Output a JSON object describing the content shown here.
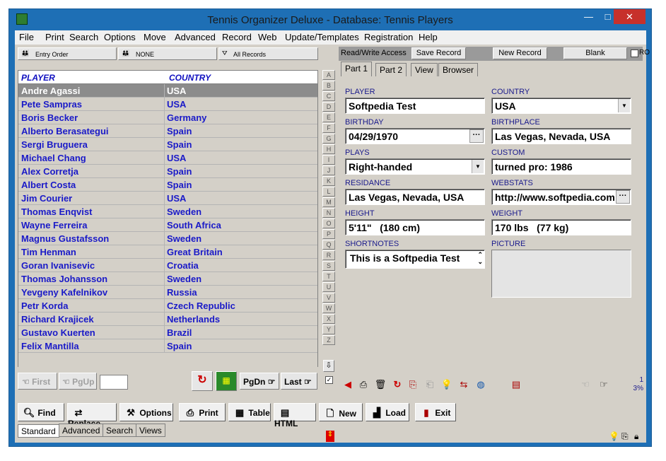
{
  "window": {
    "title": "Tennis Organizer Deluxe - Database: Tennis Players",
    "min": "—",
    "max": "□",
    "close": "✕"
  },
  "menu": [
    "File",
    "Print",
    "Search",
    "Options",
    "Move",
    "Advanced",
    "Record",
    "Web",
    "Update/Templates",
    "Registration",
    "Help"
  ],
  "sortbar": {
    "entry_order": "Entry Order",
    "none": "NONE",
    "all_records": "All Records"
  },
  "list": {
    "columns": [
      "PLAYER",
      "COUNTRY"
    ],
    "rows": [
      {
        "player": "Andre Agassi",
        "country": "USA"
      },
      {
        "player": "Pete Sampras",
        "country": "USA"
      },
      {
        "player": "Boris Becker",
        "country": "Germany"
      },
      {
        "player": "Alberto Berasategui",
        "country": "Spain"
      },
      {
        "player": "Sergi Bruguera",
        "country": "Spain"
      },
      {
        "player": "Michael Chang",
        "country": "USA"
      },
      {
        "player": "Alex Corretja",
        "country": "Spain"
      },
      {
        "player": "Albert Costa",
        "country": "Spain"
      },
      {
        "player": "Jim Courier",
        "country": "USA"
      },
      {
        "player": "Thomas Enqvist",
        "country": "Sweden"
      },
      {
        "player": "Wayne Ferreira",
        "country": "South Africa"
      },
      {
        "player": "Magnus Gustafsson",
        "country": "Sweden"
      },
      {
        "player": "Tim Henman",
        "country": "Great Britain"
      },
      {
        "player": "Goran Ivanisevic",
        "country": "Croatia"
      },
      {
        "player": "Thomas Johansson",
        "country": "Sweden"
      },
      {
        "player": "Yevgeny Kafelnikov",
        "country": "Russia"
      },
      {
        "player": "Petr Korda",
        "country": "Czech Republic"
      },
      {
        "player": "Richard Krajicek",
        "country": "Netherlands"
      },
      {
        "player": "Gustavo Kuerten",
        "country": "Brazil"
      },
      {
        "player": "Felix Mantilla",
        "country": "Spain"
      }
    ]
  },
  "alphabet": [
    "A",
    "B",
    "C",
    "D",
    "E",
    "F",
    "G",
    "H",
    "I",
    "J",
    "K",
    "L",
    "M",
    "N",
    "O",
    "P",
    "Q",
    "R",
    "S",
    "T",
    "U",
    "V",
    "W",
    "X",
    "Y",
    "Z"
  ],
  "nav": {
    "first": "First",
    "pgup": "PgUp",
    "pgdn": "PgDn",
    "last": "Last"
  },
  "record_bar": {
    "access": "Read/Write Access",
    "save": "Save Record",
    "new": "New Record",
    "blank": "Blank",
    "ro": "RO"
  },
  "tabs": [
    "Part 1",
    "Part 2",
    "View",
    "Browser"
  ],
  "form": {
    "player_label": "PLAYER",
    "player": "Softpedia Test",
    "country_label": "COUNTRY",
    "country": "USA",
    "birthday_label": "BIRTHDAY",
    "birthday": "04/29/1970",
    "birthplace_label": "BIRTHPLACE",
    "birthplace": "Las Vegas, Nevada, USA",
    "plays_label": "PLAYS",
    "plays": "Right-handed",
    "custom_label": "CUSTOM",
    "custom": "turned pro: 1986",
    "residance_label": "RESIDANCE",
    "residance": "Las Vegas, Nevada, USA",
    "webstats_label": "WEBSTATS",
    "webstats": "http://www.softpedia.com",
    "height_label": "HEIGHT",
    "height": "5'11\"   (180 cm)",
    "weight_label": "WEIGHT",
    "weight": "170 lbs   (77 kg)",
    "shortnotes_label": "SHORTNOTES",
    "shortnotes": "This is a Softpedia Test",
    "picture_label": "PICTURE",
    "ellipsis": "···"
  },
  "status": {
    "count": "1",
    "percent": "3%"
  },
  "buttons": [
    "Find",
    "Replace",
    "Options",
    "Print",
    "Table",
    "HTML",
    "New",
    "Load",
    "Exit"
  ],
  "view_tabs": [
    "Standard",
    "Advanced",
    "Search",
    "Views"
  ]
}
